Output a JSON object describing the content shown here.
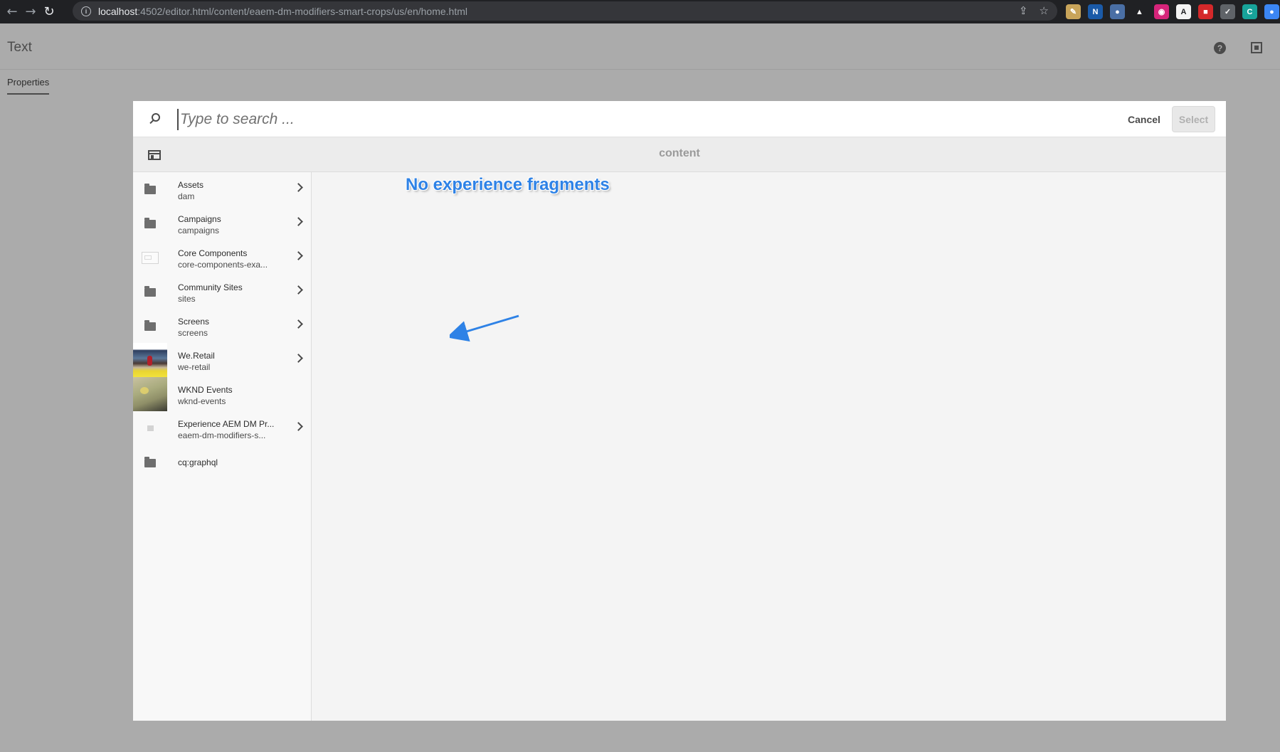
{
  "browser": {
    "url_host": "localhost",
    "url_path": ":4502/editor.html/content/eaem-dm-modifiers-smart-crops/us/en/home.html",
    "extensions": [
      {
        "icon": "pen-extension-icon",
        "color": "#c8a45a",
        "glyph": "✎"
      },
      {
        "icon": "n-extension-icon",
        "color": "#1a5aa8",
        "glyph": "N"
      },
      {
        "icon": "circle-extension-icon",
        "color": "#4a6fa5",
        "glyph": "●"
      },
      {
        "icon": "hat-extension-icon",
        "color": "#202124",
        "glyph": "▲"
      },
      {
        "icon": "pink-circle-extension-icon",
        "color": "#d6247a",
        "glyph": "◉"
      },
      {
        "icon": "adobe-extension-icon",
        "color": "#f4f4f4",
        "glyph": "A"
      },
      {
        "icon": "red-extension-icon",
        "color": "#d4282a",
        "glyph": "■"
      },
      {
        "icon": "wrench-extension-icon",
        "color": "#5f6368",
        "glyph": "✓"
      },
      {
        "icon": "c-extension-icon",
        "color": "#17a39a",
        "glyph": "C"
      },
      {
        "icon": "blue-extension-icon",
        "color": "#3b86f4",
        "glyph": "●"
      }
    ]
  },
  "dialog": {
    "title": "Text",
    "tab": "Properties"
  },
  "picker": {
    "search_placeholder": "Type to search ...",
    "cancel_label": "Cancel",
    "select_label": "Select",
    "path_title": "content",
    "items": [
      {
        "title": "Assets",
        "subtitle": "dam",
        "thumb": "folder",
        "has_children": true
      },
      {
        "title": "Campaigns",
        "subtitle": "campaigns",
        "thumb": "folder",
        "has_children": true
      },
      {
        "title": "Core Components",
        "subtitle": "core-components-exa...",
        "thumb": "page",
        "has_children": true
      },
      {
        "title": "Community Sites",
        "subtitle": "sites",
        "thumb": "folder",
        "has_children": true
      },
      {
        "title": "Screens",
        "subtitle": "screens",
        "thumb": "folder",
        "has_children": true
      },
      {
        "title": "We.Retail",
        "subtitle": "we-retail",
        "thumb": "photo-retail",
        "has_children": true
      },
      {
        "title": "WKND Events",
        "subtitle": "wknd-events",
        "thumb": "photo-wknd",
        "has_children": false
      },
      {
        "title": "Experience AEM DM Pr...",
        "subtitle": "eaem-dm-modifiers-s...",
        "thumb": "doc",
        "has_children": true
      },
      {
        "title": "cq:graphql",
        "subtitle": "",
        "thumb": "folder",
        "has_children": false
      }
    ]
  },
  "annotation": {
    "text": "No experience fragments",
    "color": "#2e82e6"
  }
}
